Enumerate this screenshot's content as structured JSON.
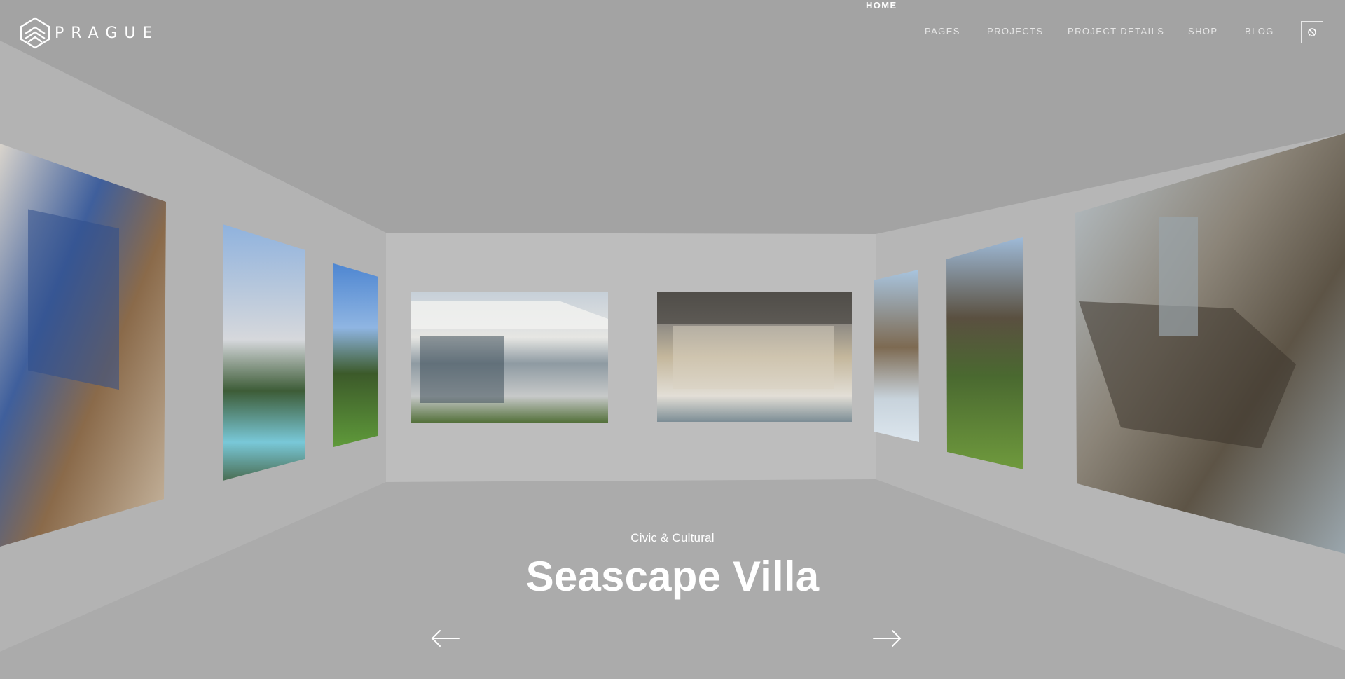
{
  "brand": {
    "name": "PRAGUE",
    "logo_icon": "stacked-chevron-logo-icon"
  },
  "nav": {
    "items": [
      {
        "label": "HOME",
        "active": true
      },
      {
        "label": "PAGES",
        "active": false
      },
      {
        "label": "PROJECTS",
        "active": false
      },
      {
        "label": "PROJECT DETAILS",
        "active": false
      },
      {
        "label": "SHOP",
        "active": false
      },
      {
        "label": "BLOG",
        "active": false
      }
    ],
    "utility_icon": "theme-toggle-icon"
  },
  "slide": {
    "category": "Civic & Cultural",
    "title": "Seascape Villa"
  },
  "controls": {
    "prev_icon": "arrow-left-icon",
    "next_icon": "arrow-right-icon"
  },
  "gallery": {
    "images": [
      {
        "subject": "kitchen-dining-interior",
        "wall": "left"
      },
      {
        "subject": "modern-house-with-pool",
        "wall": "left"
      },
      {
        "subject": "house-among-trees",
        "wall": "left"
      },
      {
        "subject": "cliffside-glass-villa",
        "wall": "back"
      },
      {
        "subject": "open-living-room-terrace",
        "wall": "back"
      },
      {
        "subject": "sail-shaped-tower",
        "wall": "right"
      },
      {
        "subject": "curved-treehouse-pavilion",
        "wall": "right"
      },
      {
        "subject": "futuristic-civic-building",
        "wall": "right"
      }
    ]
  },
  "colors": {
    "ceiling": "#a3a3a3",
    "floor": "#ababab",
    "side_wall": "#b4b4b4",
    "back_wall": "#bdbdbd",
    "text": "#ffffff"
  }
}
